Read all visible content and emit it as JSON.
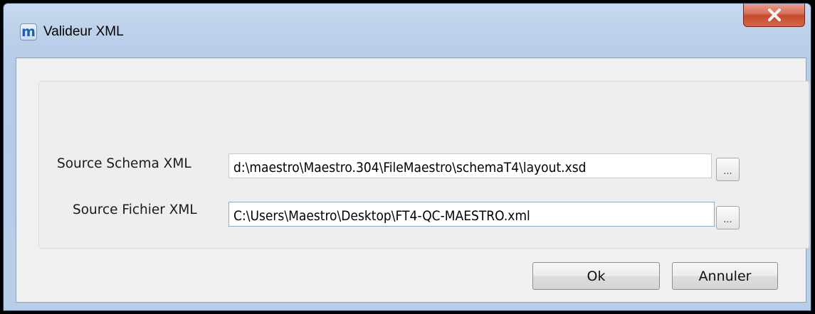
{
  "window": {
    "title": "Valideur XML",
    "app_icon_letter": "m",
    "close_icon": "close-x-icon"
  },
  "form": {
    "schema": {
      "label": "Source Schema XML",
      "value": "d:\\maestro\\Maestro.304\\FileMaestro\\schemaT4\\layout.xsd",
      "browse_label": "..."
    },
    "file": {
      "label": "Source Fichier XML",
      "value": "C:\\Users\\Maestro\\Desktop\\FT4-QC-MAESTRO.xml",
      "browse_label": "..."
    }
  },
  "buttons": {
    "ok_label": "Ok",
    "cancel_label": "Annuler"
  },
  "colors": {
    "close_button": "#c64a2c",
    "title_bar": "#bcd1ea"
  }
}
